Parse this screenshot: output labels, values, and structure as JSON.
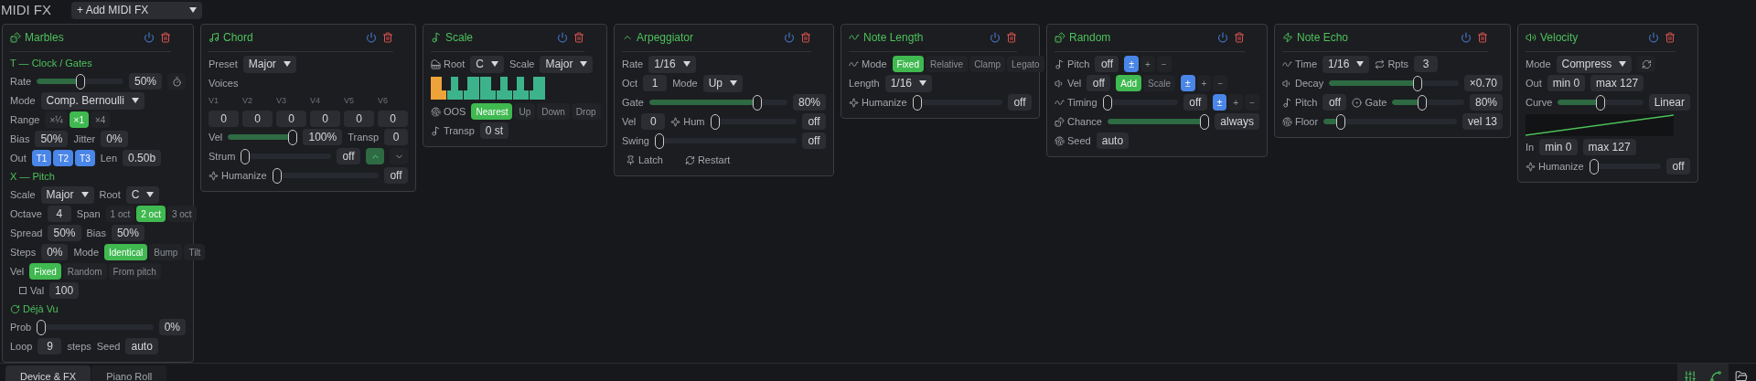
{
  "title": "MIDI FX",
  "add_menu": "+ Add MIDI FX",
  "devices": [
    {
      "name": "Marbles",
      "rows": [
        {
          "kind": "section",
          "text": "T — Clock / Gates"
        },
        {
          "kind": "row",
          "items": [
            {
              "kind": "label",
              "text": "Rate"
            },
            {
              "kind": "slider",
              "level": 0.5
            },
            {
              "kind": "value",
              "text": "50%"
            },
            {
              "kind": "button",
              "selected": false
            }
          ]
        },
        {
          "kind": "row",
          "items": [
            {
              "kind": "label",
              "text": "Mode"
            },
            {
              "kind": "select",
              "text": "Comp. Bernoulli"
            }
          ]
        },
        {
          "kind": "row",
          "items": [
            {
              "kind": "label",
              "text": "Range"
            },
            {
              "kind": "modes",
              "options": [
                {
                  "label": "×¼",
                  "selected": false
                },
                {
                  "label": "×1",
                  "selected": true
                },
                {
                  "label": "×4",
                  "selected": false
                }
              ]
            }
          ]
        },
        {
          "kind": "row",
          "items": [
            {
              "kind": "label",
              "text": "Bias"
            },
            {
              "kind": "value",
              "text": "50%"
            },
            {
              "kind": "label",
              "text": "Jitter"
            },
            {
              "kind": "value",
              "text": "0%"
            }
          ]
        },
        {
          "kind": "row",
          "items": [
            {
              "kind": "label",
              "text": "Out"
            },
            {
              "kind": "flags",
              "options": [
                {
                  "label": "T1",
                  "selected": true
                },
                {
                  "label": "T2",
                  "selected": true
                },
                {
                  "label": "T3",
                  "selected": true
                }
              ]
            },
            {
              "kind": "label",
              "text": "Len"
            },
            {
              "kind": "value",
              "text": "0.50b"
            }
          ]
        },
        {
          "kind": "section",
          "text": "X — Pitch"
        },
        {
          "kind": "row",
          "items": [
            {
              "kind": "label",
              "text": "Scale"
            },
            {
              "kind": "select",
              "text": "Major"
            },
            {
              "kind": "label",
              "text": "Root"
            },
            {
              "kind": "select",
              "text": "C"
            }
          ]
        },
        {
          "kind": "row",
          "items": [
            {
              "kind": "label",
              "text": "Octave"
            },
            {
              "kind": "value",
              "text": "4"
            },
            {
              "kind": "label",
              "text": "Span"
            },
            {
              "kind": "modes",
              "options": [
                {
                  "label": "1 oct",
                  "selected": false
                },
                {
                  "label": "2 oct",
                  "selected": true
                },
                {
                  "label": "3 oct",
                  "selected": false
                }
              ]
            }
          ]
        },
        {
          "kind": "row",
          "items": [
            {
              "kind": "label",
              "text": "Spread"
            },
            {
              "kind": "value",
              "text": "50%"
            },
            {
              "kind": "label",
              "text": "Bias"
            },
            {
              "kind": "value",
              "text": "50%"
            }
          ]
        },
        {
          "kind": "row",
          "items": [
            {
              "kind": "label",
              "text": "Steps"
            },
            {
              "kind": "value",
              "text": "0%"
            },
            {
              "kind": "label",
              "text": "Mode"
            },
            {
              "kind": "modes",
              "options": [
                {
                  "label": "Identical",
                  "selected": true
                },
                {
                  "label": "Bump",
                  "selected": false
                },
                {
                  "label": "Tilt",
                  "selected": false
                }
              ]
            }
          ]
        },
        {
          "kind": "row",
          "items": [
            {
              "kind": "label",
              "text": "Vel"
            },
            {
              "kind": "modes",
              "options": [
                {
                  "label": "Fixed",
                  "selected": true
                },
                {
                  "label": "Random",
                  "selected": false
                },
                {
                  "label": "From pitch",
                  "selected": false
                }
              ]
            }
          ]
        },
        {
          "kind": "row",
          "items": [
            {
              "kind": "checkbox",
              "text": "Val",
              "checked": false
            },
            {
              "kind": "value",
              "text": "100"
            }
          ]
        },
        {
          "kind": "section",
          "text": "Déjà Vu"
        },
        {
          "kind": "row",
          "items": [
            {
              "kind": "label",
              "text": "Prob"
            },
            {
              "kind": "slider",
              "level": 0
            },
            {
              "kind": "value",
              "text": "0%"
            }
          ]
        },
        {
          "kind": "row",
          "items": [
            {
              "kind": "label",
              "text": "Loop"
            },
            {
              "kind": "value",
              "text": "9"
            },
            {
              "kind": "label",
              "text": "steps"
            },
            {
              "kind": "label",
              "text": "Seed"
            },
            {
              "kind": "value",
              "text": "auto"
            }
          ]
        }
      ]
    },
    {
      "name": "Chord",
      "rows": [
        {
          "kind": "row",
          "items": [
            {
              "kind": "label",
              "text": "Preset"
            },
            {
              "kind": "select",
              "text": "Major"
            }
          ]
        },
        {
          "kind": "row",
          "items": [
            {
              "kind": "label",
              "text": "Voices"
            }
          ]
        },
        {
          "kind": "grid",
          "items": [
            {
              "kind": "sublabel",
              "text": "V1"
            },
            {
              "kind": "sublabel",
              "text": "V2"
            },
            {
              "kind": "sublabel",
              "text": "V3"
            },
            {
              "kind": "sublabel",
              "text": "V4"
            },
            {
              "kind": "sublabel",
              "text": "V5"
            },
            {
              "kind": "sublabel",
              "text": "V6"
            }
          ]
        },
        {
          "kind": "grid",
          "items": [
            {
              "kind": "value",
              "text": "0"
            },
            {
              "kind": "value",
              "text": "0"
            },
            {
              "kind": "value",
              "text": "0"
            },
            {
              "kind": "value",
              "text": "0"
            },
            {
              "kind": "value",
              "text": "0"
            },
            {
              "kind": "value",
              "text": "0"
            }
          ]
        },
        {
          "kind": "row",
          "items": [
            {
              "kind": "label",
              "text": "Vel"
            },
            {
              "kind": "slider",
              "level": 1
            },
            {
              "kind": "value",
              "text": "100%"
            },
            {
              "kind": "label",
              "text": "Transp"
            },
            {
              "kind": "value",
              "text": "0"
            }
          ]
        },
        {
          "kind": "row",
          "items": [
            {
              "kind": "label",
              "text": "Strum"
            },
            {
              "kind": "slider",
              "level": 0
            },
            {
              "kind": "value",
              "text": "off"
            },
            {
              "kind": "button",
              "selected": true
            },
            {
              "kind": "button",
              "selected": false
            }
          ]
        },
        {
          "kind": "row",
          "items": [
            {
              "kind": "label",
              "text": "Humanize"
            },
            {
              "kind": "slider",
              "level": 0
            },
            {
              "kind": "value",
              "text": "off"
            }
          ]
        }
      ]
    },
    {
      "name": "Scale",
      "rows": [
        {
          "kind": "row",
          "items": [
            {
              "kind": "label",
              "text": "Root"
            },
            {
              "kind": "select",
              "text": "C"
            },
            {
              "kind": "label",
              "text": "Scale"
            },
            {
              "kind": "select",
              "text": "Major"
            }
          ]
        },
        {
          "kind": "piano",
          "keys": [
            {
              "selected": true
            },
            {
              "selected": false
            },
            {
              "selected": false
            },
            {
              "selected": false
            },
            {
              "selected": false
            },
            {
              "selected": false
            },
            {
              "selected": false
            }
          ]
        },
        {
          "kind": "row",
          "items": [
            {
              "kind": "label",
              "text": "OOS"
            },
            {
              "kind": "modes",
              "options": [
                {
                  "label": "Nearest",
                  "selected": true
                },
                {
                  "label": "Up",
                  "selected": false
                },
                {
                  "label": "Down",
                  "selected": false
                },
                {
                  "label": "Drop",
                  "selected": false
                }
              ]
            }
          ]
        },
        {
          "kind": "row",
          "items": [
            {
              "kind": "label",
              "text": "Transp"
            },
            {
              "kind": "value",
              "text": "0 st"
            }
          ]
        }
      ]
    },
    {
      "name": "Arpeggiator",
      "rows": [
        {
          "kind": "row",
          "items": [
            {
              "kind": "label",
              "text": "Rate"
            },
            {
              "kind": "select",
              "text": "1/16"
            }
          ]
        },
        {
          "kind": "row",
          "items": [
            {
              "kind": "label",
              "text": "Oct"
            },
            {
              "kind": "value",
              "text": "1"
            },
            {
              "kind": "label",
              "text": "Mode"
            },
            {
              "kind": "select",
              "text": "Up"
            }
          ]
        },
        {
          "kind": "row",
          "items": [
            {
              "kind": "label",
              "text": "Gate"
            },
            {
              "kind": "slider",
              "level": 0.8
            },
            {
              "kind": "value",
              "text": "80%"
            }
          ]
        },
        {
          "kind": "row",
          "items": [
            {
              "kind": "label",
              "text": "Vel"
            },
            {
              "kind": "value",
              "text": "0"
            },
            {
              "kind": "label",
              "text": "Hum"
            },
            {
              "kind": "slider",
              "level": 0
            },
            {
              "kind": "value",
              "text": "off"
            }
          ]
        },
        {
          "kind": "row",
          "items": [
            {
              "kind": "label",
              "text": "Swing"
            },
            {
              "kind": "slider",
              "level": 0
            },
            {
              "kind": "value",
              "text": "off"
            }
          ]
        },
        {
          "kind": "row",
          "items": [
            {
              "kind": "action",
              "text": "Latch"
            },
            {
              "kind": "action",
              "text": "Restart"
            }
          ]
        }
      ]
    },
    {
      "name": "Note Length",
      "rows": [
        {
          "kind": "row",
          "items": [
            {
              "kind": "label",
              "text": "Mode"
            },
            {
              "kind": "modes",
              "options": [
                {
                  "label": "Fixed",
                  "selected": true
                },
                {
                  "label": "Relative",
                  "selected": false
                },
                {
                  "label": "Clamp",
                  "selected": false
                },
                {
                  "label": "Legato",
                  "selected": false
                }
              ]
            }
          ]
        },
        {
          "kind": "row",
          "items": [
            {
              "kind": "label",
              "text": "Length"
            },
            {
              "kind": "select",
              "text": "1/16"
            }
          ]
        },
        {
          "kind": "row",
          "items": [
            {
              "kind": "label",
              "text": "Humanize"
            },
            {
              "kind": "slider",
              "level": 0
            },
            {
              "kind": "value",
              "text": "off"
            }
          ]
        }
      ]
    },
    {
      "name": "Random",
      "rows": [
        {
          "kind": "row",
          "items": [
            {
              "kind": "label",
              "text": "Pitch"
            },
            {
              "kind": "value",
              "text": "off"
            },
            {
              "kind": "flags",
              "options": [
                {
                  "label": "±",
                  "selected": true
                },
                {
                  "label": "+",
                  "selected": false
                },
                {
                  "label": "−",
                  "selected": false
                }
              ]
            }
          ]
        },
        {
          "kind": "row",
          "items": [
            {
              "kind": "label",
              "text": "Vel"
            },
            {
              "kind": "value",
              "text": "off"
            },
            {
              "kind": "modes",
              "options": [
                {
                  "label": "Add",
                  "selected": true
                },
                {
                  "label": "Scale",
                  "selected": false
                }
              ]
            },
            {
              "kind": "flags",
              "options": [
                {
                  "label": "±",
                  "selected": true
                },
                {
                  "label": "+",
                  "selected": false
                },
                {
                  "label": "−",
                  "selected": false
                }
              ]
            }
          ]
        },
        {
          "kind": "row",
          "items": [
            {
              "kind": "label",
              "text": "Timing"
            },
            {
              "kind": "slider",
              "level": 0
            },
            {
              "kind": "value",
              "text": "off"
            },
            {
              "kind": "flags",
              "options": [
                {
                  "label": "±",
                  "selected": true
                },
                {
                  "label": "+",
                  "selected": false
                },
                {
                  "label": "−",
                  "selected": false
                }
              ]
            }
          ]
        },
        {
          "kind": "row",
          "items": [
            {
              "kind": "label",
              "text": "Chance"
            },
            {
              "kind": "slider",
              "level": 1
            },
            {
              "kind": "value",
              "text": "always"
            }
          ]
        },
        {
          "kind": "row",
          "items": [
            {
              "kind": "label",
              "text": "Seed"
            },
            {
              "kind": "value",
              "text": "auto"
            }
          ]
        }
      ]
    },
    {
      "name": "Note Echo",
      "rows": [
        {
          "kind": "row",
          "items": [
            {
              "kind": "label",
              "text": "Time"
            },
            {
              "kind": "select",
              "text": "1/16"
            },
            {
              "kind": "label",
              "text": "Rpts"
            },
            {
              "kind": "value",
              "text": "3"
            }
          ]
        },
        {
          "kind": "row",
          "items": [
            {
              "kind": "label",
              "text": "Decay"
            },
            {
              "kind": "slider",
              "level": 0.7
            },
            {
              "kind": "value",
              "text": "×0.70"
            }
          ]
        },
        {
          "kind": "row",
          "items": [
            {
              "kind": "label",
              "text": "Pitch"
            },
            {
              "kind": "value",
              "text": "off"
            },
            {
              "kind": "label",
              "text": "Gate"
            },
            {
              "kind": "slider",
              "level": 0.4
            },
            {
              "kind": "value",
              "text": "80%"
            }
          ]
        },
        {
          "kind": "row",
          "items": [
            {
              "kind": "label",
              "text": "Floor"
            },
            {
              "kind": "slider",
              "level": 0.1
            },
            {
              "kind": "value",
              "text": "vel 13"
            }
          ]
        }
      ]
    },
    {
      "name": "Velocity",
      "rows": [
        {
          "kind": "row",
          "items": [
            {
              "kind": "label",
              "text": "Mode"
            },
            {
              "kind": "select",
              "text": "Compress"
            },
            {
              "kind": "button",
              "selected": false
            }
          ]
        },
        {
          "kind": "row",
          "items": [
            {
              "kind": "label",
              "text": "Out"
            },
            {
              "kind": "value",
              "text": "min 0"
            },
            {
              "kind": "value",
              "text": "max 127"
            }
          ]
        },
        {
          "kind": "row",
          "items": [
            {
              "kind": "label",
              "text": "Curve"
            },
            {
              "kind": "slider",
              "level": 0.5
            },
            {
              "kind": "value",
              "text": "Linear"
            }
          ]
        },
        {
          "kind": "curve"
        },
        {
          "kind": "row",
          "items": [
            {
              "kind": "label",
              "text": "In"
            },
            {
              "kind": "value",
              "text": "min 0"
            },
            {
              "kind": "value",
              "text": "max 127"
            }
          ]
        },
        {
          "kind": "row",
          "items": [
            {
              "kind": "label",
              "text": "Humanize"
            },
            {
              "kind": "slider",
              "level": 0
            },
            {
              "kind": "value",
              "text": "off"
            }
          ]
        }
      ]
    }
  ],
  "tabs": [
    {
      "label": "Device & FX",
      "selected": true
    },
    {
      "label": "Piano Roll",
      "selected": false
    }
  ],
  "tools": [
    {
      "selected": true
    },
    {
      "selected": true
    },
    {
      "selected": false
    }
  ]
}
